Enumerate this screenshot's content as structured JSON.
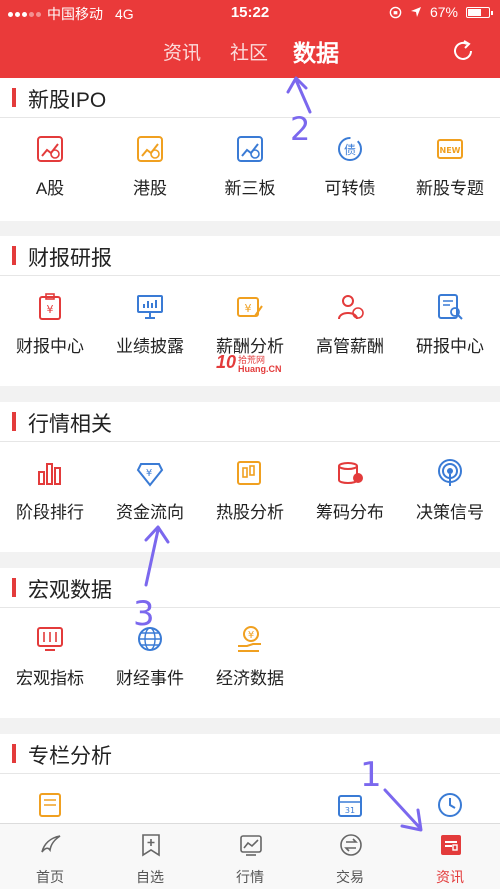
{
  "status_bar": {
    "carrier": "中国移动",
    "network": "4G",
    "time": "15:22",
    "battery": "67%",
    "battery_level": 0.67
  },
  "top_tabs": [
    {
      "label": "资讯",
      "active": false
    },
    {
      "label": "社区",
      "active": false
    },
    {
      "label": "数据",
      "active": true
    }
  ],
  "sections": [
    {
      "title": "新股IPO",
      "items": [
        {
          "label": "A股",
          "icon": "a-share-chart-icon"
        },
        {
          "label": "港股",
          "icon": "hk-stock-chart-icon"
        },
        {
          "label": "新三板",
          "icon": "new-third-board-icon"
        },
        {
          "label": "可转债",
          "icon": "convertible-bond-icon"
        },
        {
          "label": "新股专题",
          "icon": "new-stock-ticket-icon"
        }
      ]
    },
    {
      "title": "财报研报",
      "items": [
        {
          "label": "财报中心",
          "icon": "clipboard-yuan-icon"
        },
        {
          "label": "业绩披露",
          "icon": "presentation-chart-icon"
        },
        {
          "label": "薪酬分析",
          "icon": "salary-edit-icon"
        },
        {
          "label": "高管薪酬",
          "icon": "executive-person-icon"
        },
        {
          "label": "研报中心",
          "icon": "document-search-icon"
        }
      ]
    },
    {
      "title": "行情相关",
      "items": [
        {
          "label": "阶段排行",
          "icon": "bar-ranking-icon"
        },
        {
          "label": "资金流向",
          "icon": "money-flow-icon"
        },
        {
          "label": "热股分析",
          "icon": "candlestick-edit-icon"
        },
        {
          "label": "筹码分布",
          "icon": "coin-stack-icon"
        },
        {
          "label": "决策信号",
          "icon": "signal-broadcast-icon"
        }
      ]
    },
    {
      "title": "宏观数据",
      "items": [
        {
          "label": "宏观指标",
          "icon": "monitor-sliders-icon"
        },
        {
          "label": "财经事件",
          "icon": "globe-yen-icon"
        },
        {
          "label": "经济数据",
          "icon": "hand-yen-icon"
        }
      ]
    },
    {
      "title": "专栏分析",
      "items": [
        {
          "label": "",
          "icon": "column-doc-icon"
        },
        {
          "label": "",
          "icon": "column-blank-icon"
        },
        {
          "label": "",
          "icon": "column-blank-icon"
        },
        {
          "label": "",
          "icon": "column-calendar-icon"
        },
        {
          "label": "",
          "icon": "column-clock-icon"
        }
      ]
    }
  ],
  "watermark": {
    "number": "10",
    "top": "拾荒网",
    "bottom": "Huang.CN"
  },
  "annotations": [
    "1",
    "2",
    "3"
  ],
  "bottom_nav": [
    {
      "label": "首页",
      "icon": "home-swoosh-icon",
      "active": false
    },
    {
      "label": "自选",
      "icon": "bookmark-plus-icon",
      "active": false
    },
    {
      "label": "行情",
      "icon": "line-chart-icon",
      "active": false
    },
    {
      "label": "交易",
      "icon": "exchange-arrows-icon",
      "active": false
    },
    {
      "label": "资讯",
      "icon": "news-icon",
      "active": true
    }
  ],
  "colors": {
    "accent": "#ea3a3a",
    "annotation": "#7b68ee",
    "icon_red": "#e33b3b",
    "icon_orange": "#f0a020",
    "icon_blue": "#3a7bd5"
  }
}
